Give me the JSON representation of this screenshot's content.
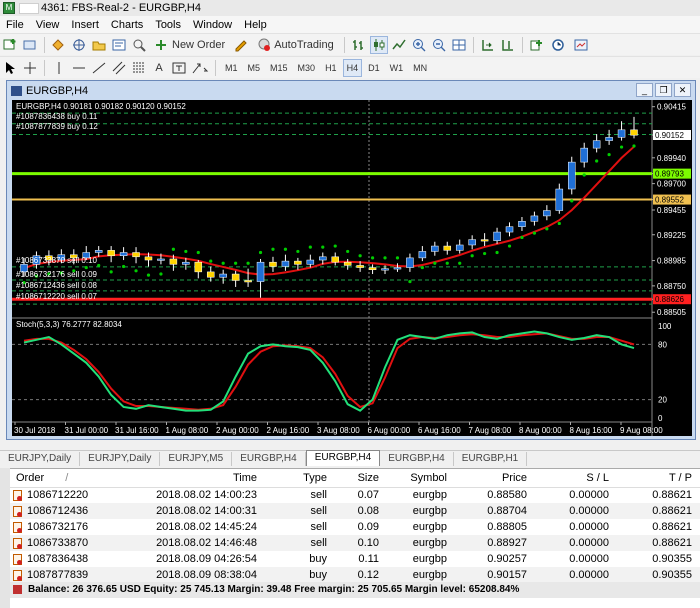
{
  "window": {
    "title_prefix": "4361: FBS-Real-2 - EURGBP,H4"
  },
  "menu": [
    "File",
    "View",
    "Insert",
    "Charts",
    "Tools",
    "Window",
    "Help"
  ],
  "toolbar": {
    "new_order": "New Order",
    "autotrading": "AutoTrading",
    "timeframes": [
      "M1",
      "M5",
      "M15",
      "M30",
      "H1",
      "H4",
      "D1",
      "W1",
      "MN"
    ],
    "active_tf": "H4"
  },
  "chart": {
    "title": "EURGBP,H4",
    "ohlc_label": "EURGBP,H4  0.90181 0.90182 0.90120 0.90152",
    "price_labels": [
      "0.90415",
      "0.90152",
      "0.89940",
      "0.89793",
      "0.89700",
      "0.89552",
      "0.89455",
      "0.89225",
      "0.88985",
      "0.88750",
      "0.88626",
      "0.88505"
    ],
    "osc_labels": [
      "100",
      "80",
      "20",
      "0"
    ],
    "osc_title": "Stoch(5,3,3) 76.2777 82.8034",
    "order_tags": [
      "#1087836438 buy 0.11",
      "#1087877839 buy 0.12",
      "#1086733870 sell 0.10",
      "#1086732176 sell 0.09",
      "#1086712436 sell 0.08",
      "#1086712220 sell 0.07"
    ],
    "time_labels": [
      "30 Jul 2018",
      "31 Jul 00:00",
      "31 Jul 16:00",
      "1 Aug 08:00",
      "2 Aug 00:00",
      "2 Aug 16:00",
      "3 Aug 08:00",
      "6 Aug 00:00",
      "6 Aug 16:00",
      "7 Aug 08:00",
      "8 Aug 00:00",
      "8 Aug 16:00",
      "9 Aug 08:00"
    ],
    "colors": {
      "bull": "#1f6fd6",
      "bear": "#ffd400",
      "ma": "#e01010",
      "psar": "#00cc00",
      "stoch_main": "#22e07a",
      "stoch_signal": "#e01010"
    }
  },
  "tabs": [
    "EURJPY,Daily",
    "EURJPY,Daily",
    "EURJPY,M5",
    "EURGBP,H4",
    "EURGBP,H4",
    "EURGBP,H4",
    "EURGBP,H1"
  ],
  "active_tab_index": 4,
  "terminal": {
    "columns": [
      "Order",
      "/",
      "Time",
      "Type",
      "Size",
      "Symbol",
      "Price",
      "S / L",
      "T / P"
    ],
    "rows": [
      [
        "1086712220",
        "2018.08.02 14:00:23",
        "sell",
        "0.07",
        "eurgbp",
        "0.88580",
        "0.00000",
        "0.88621"
      ],
      [
        "1086712436",
        "2018.08.02 14:00:31",
        "sell",
        "0.08",
        "eurgbp",
        "0.88704",
        "0.00000",
        "0.88621"
      ],
      [
        "1086732176",
        "2018.08.02 14:45:24",
        "sell",
        "0.09",
        "eurgbp",
        "0.88805",
        "0.00000",
        "0.88621"
      ],
      [
        "1086733870",
        "2018.08.02 14:46:48",
        "sell",
        "0.10",
        "eurgbp",
        "0.88927",
        "0.00000",
        "0.88621"
      ],
      [
        "1087836438",
        "2018.08.09 04:26:54",
        "buy",
        "0.11",
        "eurgbp",
        "0.90257",
        "0.00000",
        "0.90355"
      ],
      [
        "1087877839",
        "2018.08.09 08:38:04",
        "buy",
        "0.12",
        "eurgbp",
        "0.90157",
        "0.00000",
        "0.90355"
      ]
    ],
    "balance_line": "Balance: 26 376.65 USD  Equity: 25 745.13  Margin: 39.48  Free margin: 25 705.65  Margin level: 65208.84%"
  }
}
